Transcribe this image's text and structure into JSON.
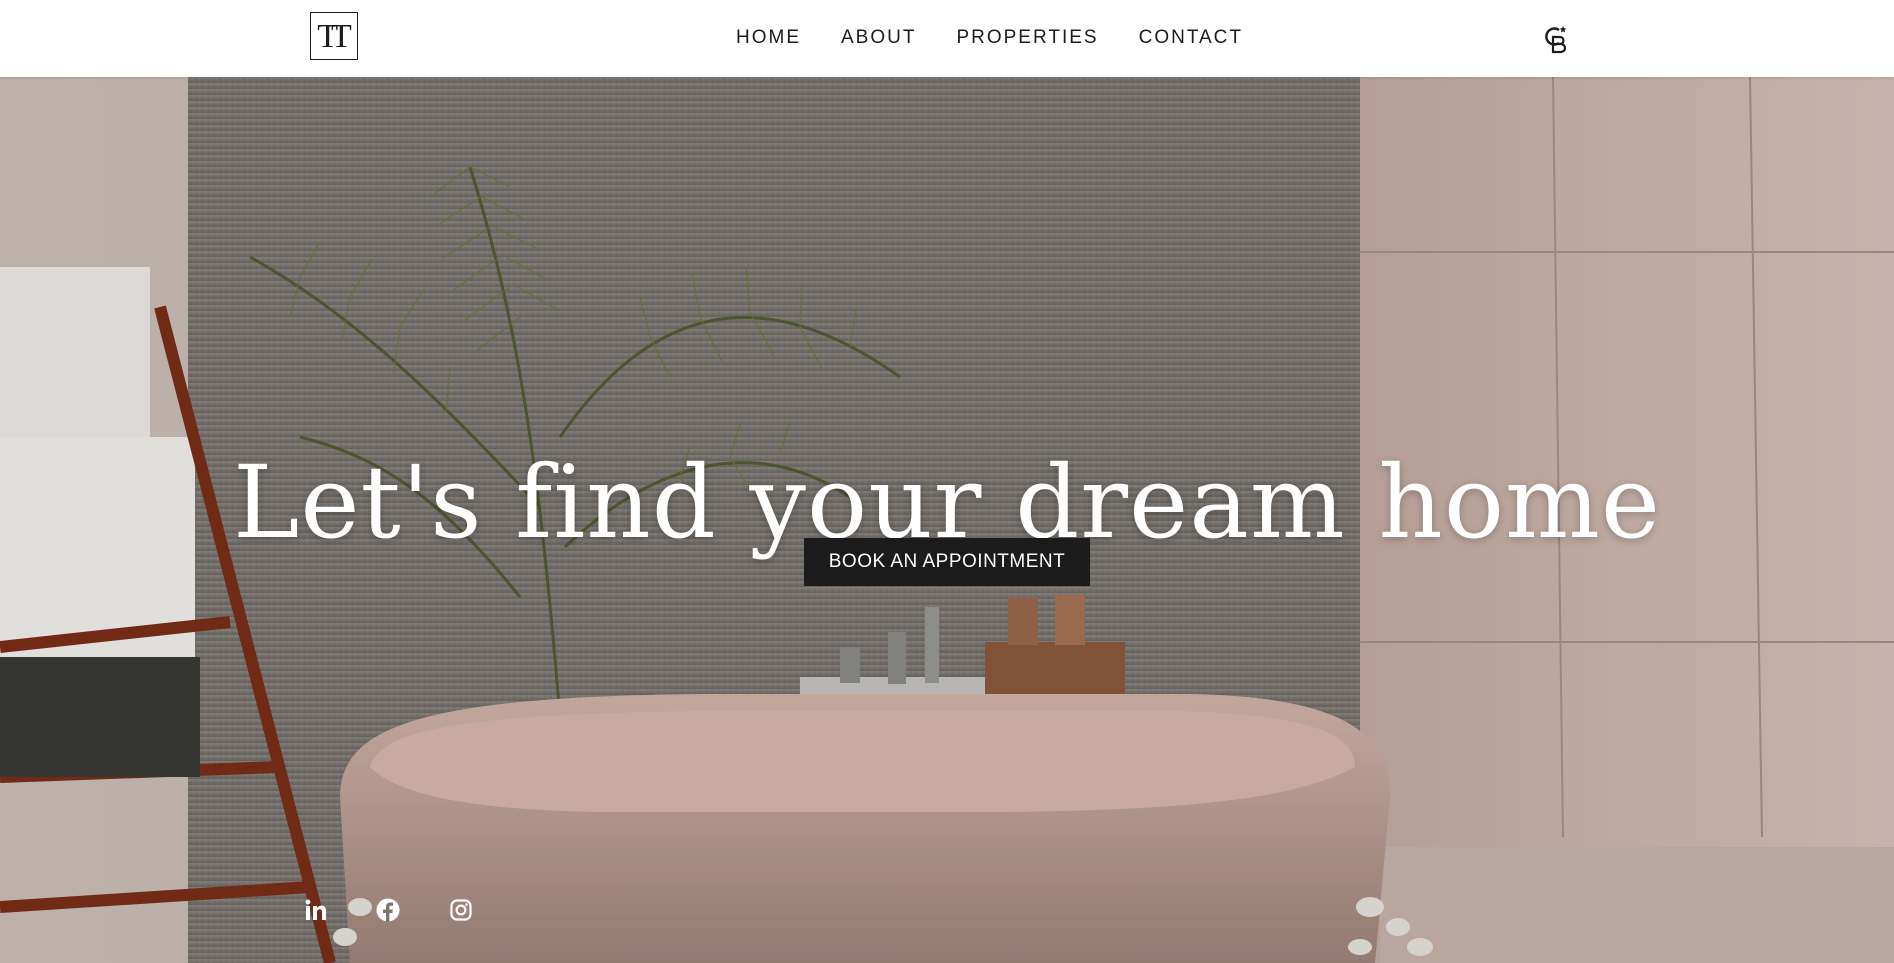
{
  "header": {
    "logo": "TT",
    "nav": [
      "HOME",
      "ABOUT",
      "PROPERTIES",
      "CONTACT"
    ],
    "brand_icon": "coldwell-banker-icon"
  },
  "hero": {
    "title": "Let's find your dream home",
    "cta_label": "BOOK AN APPOINTMENT"
  },
  "social": [
    "linkedin-icon",
    "facebook-icon",
    "instagram-icon"
  ],
  "colors": {
    "header_bg": "#ffffff",
    "text_dark": "#1c1c1c",
    "cta_bg": "#1b1b1b",
    "hero_text": "#ffffff"
  }
}
